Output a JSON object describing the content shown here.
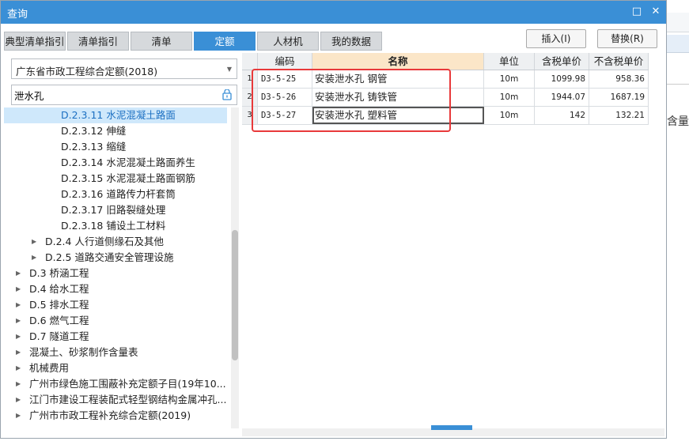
{
  "window": {
    "title": "查询",
    "maximize_symbol": "□",
    "close_symbol": "✕"
  },
  "tabs": [
    {
      "label": "典型清单指引",
      "active": false
    },
    {
      "label": "清单指引",
      "active": false
    },
    {
      "label": "清单",
      "active": false
    },
    {
      "label": "定额",
      "active": true
    },
    {
      "label": "人材机",
      "active": false
    },
    {
      "label": "我的数据",
      "active": false
    }
  ],
  "buttons": {
    "insert": "插入(I)",
    "replace": "替换(R)"
  },
  "library_select": {
    "value": "广东省市政工程综合定额(2018)"
  },
  "search": {
    "value": "泄水孔"
  },
  "tree": [
    {
      "label": "D.2.3.11 水泥混凝土路面",
      "selected": true,
      "has_toggle": false
    },
    {
      "label": "D.2.3.12 伸缝",
      "selected": false,
      "has_toggle": false
    },
    {
      "label": "D.2.3.13 缩缝",
      "selected": false,
      "has_toggle": false
    },
    {
      "label": "D.2.3.14 水泥混凝土路面养生",
      "selected": false,
      "has_toggle": false
    },
    {
      "label": "D.2.3.15 水泥混凝土路面钢筋",
      "selected": false,
      "has_toggle": false
    },
    {
      "label": "D.2.3.16 道路传力杆套筒",
      "selected": false,
      "has_toggle": false
    },
    {
      "label": "D.2.3.17 旧路裂缝处理",
      "selected": false,
      "has_toggle": false
    },
    {
      "label": "D.2.3.18 铺设土工材料",
      "selected": false,
      "has_toggle": false
    },
    {
      "label": "D.2.4 人行道侧缘石及其他",
      "selected": false,
      "has_toggle": true
    },
    {
      "label": "D.2.5 道路交通安全管理设施",
      "selected": false,
      "has_toggle": true
    },
    {
      "label": "D.3 桥涵工程",
      "selected": false,
      "has_toggle": true
    },
    {
      "label": "D.4 给水工程",
      "selected": false,
      "has_toggle": true
    },
    {
      "label": "D.5 排水工程",
      "selected": false,
      "has_toggle": true
    },
    {
      "label": "D.6 燃气工程",
      "selected": false,
      "has_toggle": true
    },
    {
      "label": "D.7 隧道工程",
      "selected": false,
      "has_toggle": true
    },
    {
      "label": "混凝土、砂浆制作含量表",
      "selected": false,
      "has_toggle": true
    },
    {
      "label": "机械费用",
      "selected": false,
      "has_toggle": true
    },
    {
      "label": "广州市绿色施工围蔽补充定额子目(19年10...",
      "selected": false,
      "has_toggle": true
    },
    {
      "label": "江门市建设工程装配式轻型钢结构金属冲孔...",
      "selected": false,
      "has_toggle": true
    },
    {
      "label": "广州市市政工程补充综合定额(2019)",
      "selected": false,
      "has_toggle": true
    }
  ],
  "grid": {
    "headers": [
      "编码",
      "名称",
      "单位",
      "含税单价",
      "不含税单价"
    ],
    "rows": [
      {
        "no": "1",
        "code": "D3-5-25",
        "name": "安装泄水孔 钢管",
        "unit": "10m",
        "price_tax": "1099.98",
        "price_notax": "958.36"
      },
      {
        "no": "2",
        "code": "D3-5-26",
        "name": "安装泄水孔 铸铁管",
        "unit": "10m",
        "price_tax": "1944.07",
        "price_notax": "1687.19"
      },
      {
        "no": "3",
        "code": "D3-5-27",
        "name": "安装泄水孔 塑料管",
        "unit": "10m",
        "price_tax": "142",
        "price_notax": "132.21"
      }
    ]
  },
  "background_window": {
    "partial_text": "含量"
  },
  "colors": {
    "accent": "#3a8fd6",
    "highlight_box": "#e8393a",
    "selected_row": "#cfe8fb",
    "active_header": "#fbe6c8"
  }
}
